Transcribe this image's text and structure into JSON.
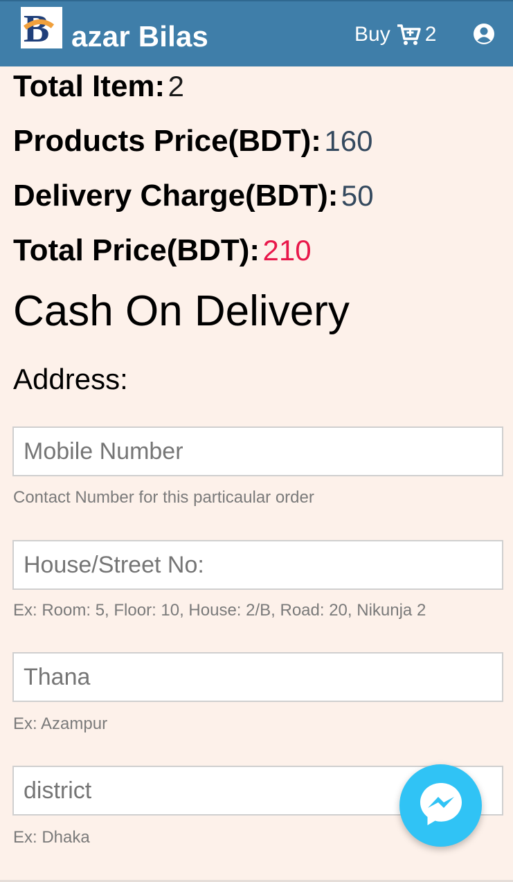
{
  "header": {
    "brand_letter": "B",
    "brand_name": "azar Bilas",
    "buy_label": "Buy",
    "cart_count": "2",
    "icons": {
      "cart": "cart-plus-icon",
      "user": "user-circle-icon",
      "logo": "brand-logo"
    },
    "color": "#3f7ea9"
  },
  "summary": {
    "total_item_label": "Total Item:",
    "total_item_value": "2",
    "products_price_label": "Products Price(BDT):",
    "products_price_value": "160",
    "delivery_charge_label": "Delivery Charge(BDT):",
    "delivery_charge_value": "50",
    "total_price_label": "Total Price(BDT):",
    "total_price_value": "210",
    "total_price_color": "#e8174a"
  },
  "payment_method": "Cash On Delivery",
  "address": {
    "label": "Address:",
    "fields": [
      {
        "placeholder": "Mobile Number",
        "hint": "Contact Number for this particaular order"
      },
      {
        "placeholder": "House/Street No:",
        "hint": "Ex: Room: 5, Floor: 10, House: 2/B, Road: 20, Nikunja 2"
      },
      {
        "placeholder": "Thana",
        "hint": "Ex: Azampur"
      },
      {
        "placeholder": "district",
        "hint": "Ex: Dhaka"
      }
    ]
  },
  "chat_widget": {
    "icon": "messenger-icon",
    "color": "#30c3f5"
  },
  "background_color": "#fdf1ea"
}
